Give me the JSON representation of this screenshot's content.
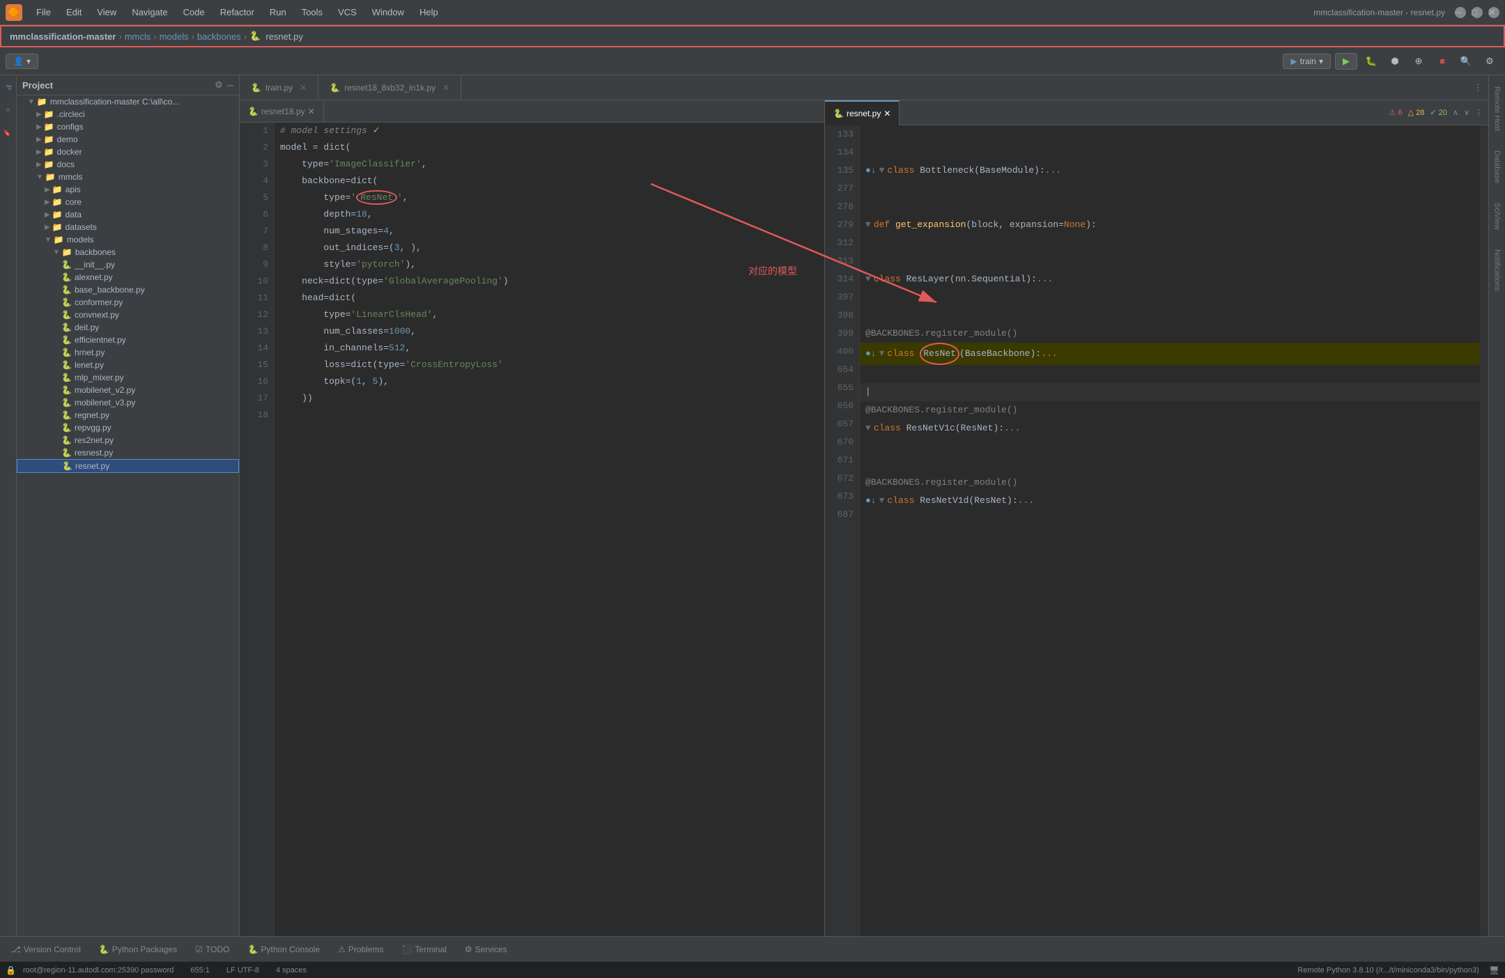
{
  "app": {
    "icon": "🔶",
    "title": "mmclassification-master - resnet.py",
    "window_controls": [
      "minimize",
      "maximize",
      "close"
    ]
  },
  "menubar": {
    "items": [
      "File",
      "Edit",
      "View",
      "Navigate",
      "Code",
      "Refactor",
      "Run",
      "Tools",
      "VCS",
      "Window",
      "Help"
    ]
  },
  "breadcrumb": {
    "parts": [
      "mmclassification-master",
      "mmcls",
      "models",
      "backbones",
      "resnet.py"
    ]
  },
  "toolbar": {
    "git_user": "👤",
    "run_config": "train",
    "run_icon": "▶",
    "debug_icon": "🐛",
    "icons": [
      "search",
      "settings"
    ]
  },
  "project_panel": {
    "title": "Project",
    "tree": [
      {
        "label": "mmclassification-master  C:\\all\\co...",
        "level": 0,
        "type": "folder",
        "expanded": true
      },
      {
        "label": ".circleci",
        "level": 1,
        "type": "folder",
        "expanded": false
      },
      {
        "label": "configs",
        "level": 1,
        "type": "folder",
        "expanded": false
      },
      {
        "label": "demo",
        "level": 1,
        "type": "folder",
        "expanded": false
      },
      {
        "label": "docker",
        "level": 1,
        "type": "folder",
        "expanded": false
      },
      {
        "label": "docs",
        "level": 1,
        "type": "folder",
        "expanded": false
      },
      {
        "label": "mmcls",
        "level": 1,
        "type": "folder",
        "expanded": true
      },
      {
        "label": "apis",
        "level": 2,
        "type": "folder",
        "expanded": false
      },
      {
        "label": "core",
        "level": 2,
        "type": "folder",
        "expanded": false
      },
      {
        "label": "data",
        "level": 2,
        "type": "folder",
        "expanded": false
      },
      {
        "label": "datasets",
        "level": 2,
        "type": "folder",
        "expanded": false
      },
      {
        "label": "models",
        "level": 2,
        "type": "folder",
        "expanded": true
      },
      {
        "label": "backbones",
        "level": 3,
        "type": "folder",
        "expanded": true
      },
      {
        "label": "__init__.py",
        "level": 4,
        "type": "file"
      },
      {
        "label": "alexnet.py",
        "level": 4,
        "type": "file"
      },
      {
        "label": "base_backbone.py",
        "level": 4,
        "type": "file"
      },
      {
        "label": "conformer.py",
        "level": 4,
        "type": "file"
      },
      {
        "label": "convnext.py",
        "level": 4,
        "type": "file"
      },
      {
        "label": "deit.py",
        "level": 4,
        "type": "file"
      },
      {
        "label": "efficientnet.py",
        "level": 4,
        "type": "file"
      },
      {
        "label": "hrnet.py",
        "level": 4,
        "type": "file"
      },
      {
        "label": "lenet.py",
        "level": 4,
        "type": "file"
      },
      {
        "label": "mlp_mixer.py",
        "level": 4,
        "type": "file"
      },
      {
        "label": "mobilenet_v2.py",
        "level": 4,
        "type": "file"
      },
      {
        "label": "mobilenet_v3.py",
        "level": 4,
        "type": "file"
      },
      {
        "label": "regnet.py",
        "level": 4,
        "type": "file"
      },
      {
        "label": "repvgg.py",
        "level": 4,
        "type": "file"
      },
      {
        "label": "res2net.py",
        "level": 4,
        "type": "file"
      },
      {
        "label": "resnest.py",
        "level": 4,
        "type": "file"
      },
      {
        "label": "resnet.py",
        "level": 4,
        "type": "file",
        "selected": true,
        "highlighted": true
      }
    ]
  },
  "left_editor": {
    "tabs": [
      {
        "label": "train.py",
        "active": false
      },
      {
        "label": "resnet18_8xb32_in1k.py",
        "active": false
      },
      {
        "label": "resnet18.py",
        "active": true
      }
    ],
    "lines": [
      {
        "num": 1,
        "content": "# model settings",
        "type": "comment",
        "checkmark": true
      },
      {
        "num": 2,
        "content": "model = dict(",
        "type": "code"
      },
      {
        "num": 3,
        "content": "    type='ImageClassifier',",
        "type": "code"
      },
      {
        "num": 4,
        "content": "    backbone=dict(",
        "type": "code"
      },
      {
        "num": 5,
        "content": "        type='ResNet',",
        "type": "code",
        "highlight_str": "ResNet"
      },
      {
        "num": 6,
        "content": "        depth=18,",
        "type": "code"
      },
      {
        "num": 7,
        "content": "        num_stages=4,",
        "type": "code"
      },
      {
        "num": 8,
        "content": "        out_indices=(3, ),",
        "type": "code"
      },
      {
        "num": 9,
        "content": "        style='pytorch'),",
        "type": "code"
      },
      {
        "num": 10,
        "content": "    neck=dict(type='GlobalAveragePooling')",
        "type": "code"
      },
      {
        "num": 11,
        "content": "    head=dict(",
        "type": "code"
      },
      {
        "num": 12,
        "content": "        type='LinearClsHead',",
        "type": "code"
      },
      {
        "num": 13,
        "content": "        num_classes=1000,",
        "type": "code"
      },
      {
        "num": 14,
        "content": "        in_channels=512,",
        "type": "code"
      },
      {
        "num": 15,
        "content": "        loss=dict(type='CrossEntropyLoss'",
        "type": "code"
      },
      {
        "num": 16,
        "content": "        topk=(1, 5),",
        "type": "code"
      },
      {
        "num": 17,
        "content": "    ))",
        "type": "code"
      },
      {
        "num": 18,
        "content": "",
        "type": "code"
      }
    ]
  },
  "right_editor": {
    "tab": "resnet.py",
    "warnings": {
      "error": 6,
      "warning": 28,
      "info": 20
    },
    "lines": [
      {
        "num": 133,
        "content": "",
        "type": "empty"
      },
      {
        "num": 134,
        "content": "",
        "type": "empty"
      },
      {
        "num": 135,
        "content": "class Bottleneck(BaseModule):...",
        "type": "class",
        "has_bp": true,
        "has_collapse": true
      },
      {
        "num": 277,
        "content": "",
        "type": "empty"
      },
      {
        "num": 278,
        "content": "",
        "type": "empty"
      },
      {
        "num": 279,
        "content": "def get_expansion(block, expansion=None):",
        "type": "def"
      },
      {
        "num": 312,
        "content": "",
        "type": "empty"
      },
      {
        "num": 313,
        "content": "",
        "type": "empty"
      },
      {
        "num": 314,
        "content": "class ResLayer(nn.Sequential):...",
        "type": "class",
        "has_collapse": true
      },
      {
        "num": 397,
        "content": "",
        "type": "empty"
      },
      {
        "num": 398,
        "content": "",
        "type": "empty"
      },
      {
        "num": 399,
        "content": "@BACKBONES.register_module()",
        "type": "decorator"
      },
      {
        "num": 400,
        "content": "class ResNet(BaseBackbone):...",
        "type": "class",
        "has_bp": true,
        "has_collapse": true,
        "highlighted": true
      },
      {
        "num": 654,
        "content": "",
        "type": "empty"
      },
      {
        "num": 655,
        "content": "",
        "type": "active_line"
      },
      {
        "num": 656,
        "content": "@BACKBONES.register_module()",
        "type": "decorator"
      },
      {
        "num": 657,
        "content": "class ResNetV1c(ResNet):...",
        "type": "class",
        "has_collapse": true
      },
      {
        "num": 670,
        "content": "",
        "type": "empty"
      },
      {
        "num": 671,
        "content": "",
        "type": "empty"
      },
      {
        "num": 672,
        "content": "@BACKBONES.register_module()",
        "type": "decorator"
      },
      {
        "num": 673,
        "content": "class ResNetV1d(ResNet):...",
        "type": "class",
        "has_bp": true,
        "has_collapse": true
      },
      {
        "num": 687,
        "content": "",
        "type": "empty"
      }
    ]
  },
  "annotation": {
    "label": "对应的模型"
  },
  "bottom_tabs": [
    {
      "label": "Version Control",
      "active": false,
      "icon": "⎇"
    },
    {
      "label": "Python Packages",
      "active": false,
      "icon": "🐍"
    },
    {
      "label": "TODO",
      "active": false,
      "icon": "☑"
    },
    {
      "label": "Python Console",
      "active": false,
      "icon": "🐍"
    },
    {
      "label": "Problems",
      "active": false,
      "icon": "⚠"
    },
    {
      "label": "Terminal",
      "active": false,
      "icon": "⬛"
    },
    {
      "label": "Services",
      "active": false,
      "icon": "⚙"
    }
  ],
  "statusbar": {
    "ssh": "root@region-11.autodl.com:25390 password",
    "position": "655:1",
    "encoding": "LF  UTF-8",
    "indent": "4 spaces",
    "interpreter": "Remote Python 3.8.10 (/r.../t/miniconda3/bin/python3)"
  },
  "right_side_panels": [
    "Remote Host",
    "Database",
    "SciView",
    "Notifications"
  ]
}
